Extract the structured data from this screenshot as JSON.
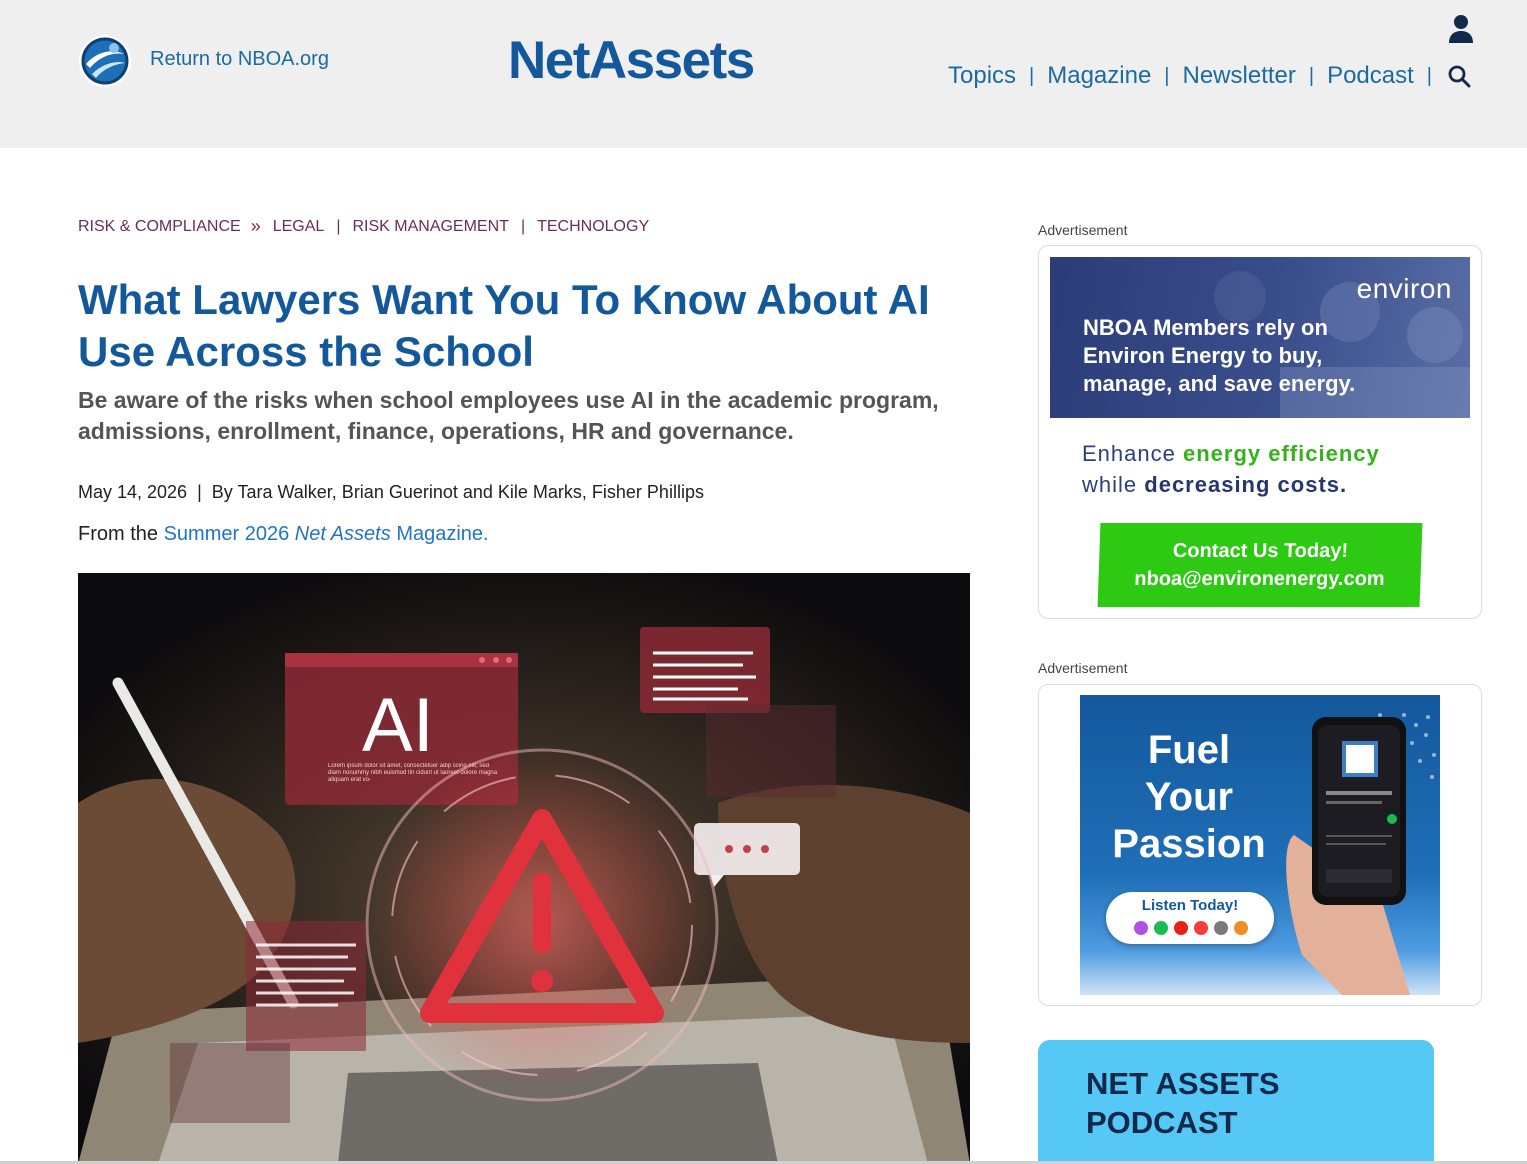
{
  "header": {
    "return_link": "Return to NBOA.org",
    "brand": "NetAssets",
    "nav": [
      "Topics",
      "Magazine",
      "Newsletter",
      "Podcast"
    ],
    "separator": "|",
    "colors": {
      "brand": "#14589c",
      "link": "#1c6aa3",
      "header_bg": "#efefef"
    }
  },
  "breadcrumbs": {
    "primary": "RISK & COMPLIANCE",
    "tags": [
      "LEGAL",
      "RISK MANAGEMENT",
      "TECHNOLOGY"
    ]
  },
  "article": {
    "title": "What Lawyers Want You To Know About AI Use Across the School",
    "subtitle": "Be aware of the risks when school employees use AI in the academic program, admissions, enrollment, finance, operations, HR and governance.",
    "date": "May 14, 2026",
    "byline": "By Tara Walker, Brian Guerinot and Kile Marks, Fisher Phillips",
    "from_prefix": "From the",
    "issue_link_start": "Summer 2026",
    "issue_link_em": "Net Assets",
    "issue_link_end": "Magazine.",
    "hero_image": {
      "ai_label": "AI",
      "lorem": "Lorem ipsum dolor sit amet, consectetuer adip scing elit, sed diam nonummy nibh euismod tin cidunt ut laoreet dolore magna aliquam erat vo-"
    }
  },
  "sidebar": {
    "ad_label": "Advertisement",
    "environ_ad": {
      "logo": "environ",
      "headline": "NBOA Members rely on Environ Energy to buy, manage, and save energy.",
      "tag_1": "Enhance",
      "tag_2": "energy efficiency",
      "tag_3": "while",
      "tag_4": "decreasing costs.",
      "button_line_1": "Contact Us Today!",
      "button_line_2": "nboa@environenergy.com"
    },
    "podcast_ad": {
      "headline_1": "Fuel",
      "headline_2": "Your",
      "headline_3": "Passion",
      "listen": "Listen Today!"
    },
    "podcast_card": {
      "title": "NET ASSETS PODCAST"
    }
  }
}
